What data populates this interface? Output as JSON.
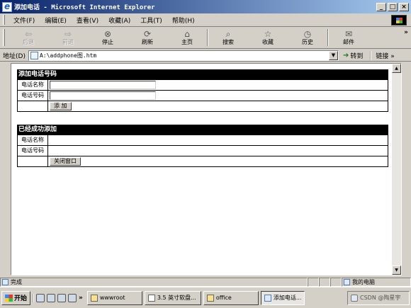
{
  "window": {
    "title": "添加电话 - Microsoft Internet Explorer"
  },
  "menu": [
    "文件(F)",
    "编辑(E)",
    "查看(V)",
    "收藏(A)",
    "工具(T)",
    "帮助(H)"
  ],
  "toolbar": {
    "back": "后退",
    "forward": "前进",
    "stop": "停止",
    "refresh": "刷新",
    "home": "主页",
    "search": "搜索",
    "favorites": "收藏",
    "history": "历史",
    "mail": "邮件",
    "more": "»"
  },
  "address": {
    "label": "地址(D)",
    "value": "A:\\addphone图.htm",
    "go": "转到",
    "links": "链接 »"
  },
  "add_form": {
    "header": "添加电话号码",
    "name_label": "电话名称",
    "name_value": "",
    "number_label": "电话号码",
    "number_value": "",
    "add_button": "添 加"
  },
  "added": {
    "header": "已经成功添加",
    "name_label": "电话名称",
    "name_value": "",
    "number_label": "电话号码",
    "number_value": "",
    "close_button": "关闭窗口"
  },
  "status": {
    "text": "完成",
    "zone": "我的电脑"
  },
  "taskbar": {
    "start": "开始",
    "more": "»",
    "tasks": [
      {
        "label": "wwwroot",
        "icon": "folder"
      },
      {
        "label": "3.5 英寸软盘...",
        "icon": "drive"
      },
      {
        "label": "office",
        "icon": "folder"
      },
      {
        "label": "添加电话...",
        "icon": "ie"
      }
    ],
    "tray": "CSDN @陶星宇"
  }
}
